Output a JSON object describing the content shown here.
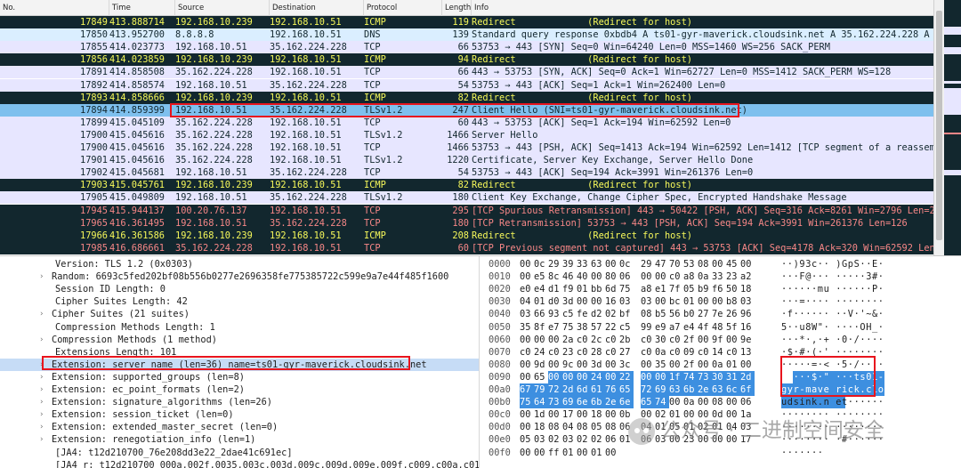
{
  "packet_list": {
    "columns": [
      "No.",
      "Time",
      "Source",
      "Destination",
      "Protocol",
      "Length",
      "Info"
    ],
    "rows": [
      {
        "no": "17849",
        "time": "413.888714",
        "src": "192.168.10.239",
        "dst": "192.168.10.51",
        "proto": "ICMP",
        "len": "119",
        "info": "Redirect             (Redirect for host)",
        "style": "icmp"
      },
      {
        "no": "17850",
        "time": "413.952700",
        "src": "8.8.8.8",
        "dst": "192.168.10.51",
        "proto": "DNS",
        "len": "139",
        "info": "Standard query response 0xbdb4 A ts01-gyr-maverick.cloudsink.net A 35.162.224.228 A 100…",
        "style": "dns"
      },
      {
        "no": "17855",
        "time": "414.023773",
        "src": "192.168.10.51",
        "dst": "35.162.224.228",
        "proto": "TCP",
        "len": "66",
        "info": "53753 → 443 [SYN] Seq=0 Win=64240 Len=0 MSS=1460 WS=256 SACK_PERM",
        "style": "tcp"
      },
      {
        "no": "17856",
        "time": "414.023859",
        "src": "192.168.10.239",
        "dst": "192.168.10.51",
        "proto": "ICMP",
        "len": "94",
        "info": "Redirect             (Redirect for host)",
        "style": "icmp"
      },
      {
        "no": "17891",
        "time": "414.858508",
        "src": "35.162.224.228",
        "dst": "192.168.10.51",
        "proto": "TCP",
        "len": "66",
        "info": "443 → 53753 [SYN, ACK] Seq=0 Ack=1 Win=62727 Len=0 MSS=1412 SACK_PERM WS=128",
        "style": "tcp"
      },
      {
        "no": "17892",
        "time": "414.858574",
        "src": "192.168.10.51",
        "dst": "35.162.224.228",
        "proto": "TCP",
        "len": "54",
        "info": "53753 → 443 [ACK] Seq=1 Ack=1 Win=262400 Len=0",
        "style": "tcp"
      },
      {
        "no": "17893",
        "time": "414.858666",
        "src": "192.168.10.239",
        "dst": "192.168.10.51",
        "proto": "ICMP",
        "len": "82",
        "info": "Redirect             (Redirect for host)",
        "style": "icmp"
      },
      {
        "no": "17894",
        "time": "414.859399",
        "src": "192.168.10.51",
        "dst": "35.162.224.228",
        "proto": "TLSv1.2",
        "len": "247",
        "info": "Client Hello (SNI=ts01-gyr-maverick.cloudsink.net)",
        "style": "selected"
      },
      {
        "no": "17899",
        "time": "415.045109",
        "src": "35.162.224.228",
        "dst": "192.168.10.51",
        "proto": "TCP",
        "len": "60",
        "info": "443 → 53753 [ACK] Seq=1 Ack=194 Win=62592 Len=0",
        "style": "tcp"
      },
      {
        "no": "17900",
        "time": "415.045616",
        "src": "35.162.224.228",
        "dst": "192.168.10.51",
        "proto": "TLSv1.2",
        "len": "1466",
        "info": "Server Hello",
        "style": "tls"
      },
      {
        "no": "17900",
        "time": "415.045616",
        "src": "35.162.224.228",
        "dst": "192.168.10.51",
        "proto": "TCP",
        "len": "1466",
        "info": "53753 → 443 [PSH, ACK] Seq=1413 Ack=194 Win=62592 Len=1412 [TCP segment of a reassemble…",
        "style": "tcp"
      },
      {
        "no": "17901",
        "time": "415.045616",
        "src": "35.162.224.228",
        "dst": "192.168.10.51",
        "proto": "TLSv1.2",
        "len": "1220",
        "info": "Certificate, Server Key Exchange, Server Hello Done",
        "style": "tls"
      },
      {
        "no": "17902",
        "time": "415.045681",
        "src": "192.168.10.51",
        "dst": "35.162.224.228",
        "proto": "TCP",
        "len": "54",
        "info": "53753 → 443 [ACK] Seq=194 Ack=3991 Win=261376 Len=0",
        "style": "tcp"
      },
      {
        "no": "17903",
        "time": "415.045761",
        "src": "192.168.10.239",
        "dst": "192.168.10.51",
        "proto": "ICMP",
        "len": "82",
        "info": "Redirect             (Redirect for host)",
        "style": "icmp"
      },
      {
        "no": "17905",
        "time": "415.049809",
        "src": "192.168.10.51",
        "dst": "35.162.224.228",
        "proto": "TLSv1.2",
        "len": "180",
        "info": "Client Key Exchange, Change Cipher Spec, Encrypted Handshake Message",
        "style": "tls"
      },
      {
        "no": "17945",
        "time": "415.944137",
        "src": "100.20.76.137",
        "dst": "192.168.10.51",
        "proto": "TCP",
        "len": "295",
        "info": "[TCP Spurious Retransmission] 443 → 50422 [PSH, ACK] Seq=316 Ack=8261 Win=2796 Len=241",
        "style": "tcpbad"
      },
      {
        "no": "17965",
        "time": "416.361495",
        "src": "192.168.10.51",
        "dst": "35.162.224.228",
        "proto": "TCP",
        "len": "180",
        "info": "[TCP Retransmission] 53753 → 443 [PSH, ACK] Seq=194 Ack=3991 Win=261376 Len=126",
        "style": "tcpbad"
      },
      {
        "no": "17966",
        "time": "416.361586",
        "src": "192.168.10.239",
        "dst": "192.168.10.51",
        "proto": "ICMP",
        "len": "208",
        "info": "Redirect             (Redirect for host)",
        "style": "icmp"
      },
      {
        "no": "17985",
        "time": "416.686661",
        "src": "35.162.224.228",
        "dst": "192.168.10.51",
        "proto": "TCP",
        "len": "60",
        "info": "[TCP Previous segment not captured] 443 → 53753 [ACK] Seq=4178 Ack=320 Win=62592 Len=0",
        "style": "tcpbad"
      }
    ]
  },
  "details": {
    "lines": [
      {
        "text": "Version: TLS 1.2 (0x0303)",
        "arrow": "",
        "selected": false
      },
      {
        "text": "Random: 6693c5fed202bf08b556b0277e2696358fe775385722c599e9a7e44f485f1600",
        "arrow": "›",
        "selected": false
      },
      {
        "text": "Session ID Length: 0",
        "arrow": "",
        "selected": false
      },
      {
        "text": "Cipher Suites Length: 42",
        "arrow": "",
        "selected": false
      },
      {
        "text": "Cipher Suites (21 suites)",
        "arrow": "›",
        "selected": false
      },
      {
        "text": "Compression Methods Length: 1",
        "arrow": "",
        "selected": false
      },
      {
        "text": "Compression Methods (1 method)",
        "arrow": "›",
        "selected": false
      },
      {
        "text": "Extensions Length: 101",
        "arrow": "",
        "selected": false
      },
      {
        "text": "Extension: server_name (len=36) name=ts01-gyr-maverick.cloudsink.net",
        "arrow": "›",
        "selected": true
      },
      {
        "text": "Extension: supported_groups (len=8)",
        "arrow": "›",
        "selected": false
      },
      {
        "text": "Extension: ec_point_formats (len=2)",
        "arrow": "›",
        "selected": false
      },
      {
        "text": "Extension: signature_algorithms (len=26)",
        "arrow": "›",
        "selected": false
      },
      {
        "text": "Extension: session_ticket (len=0)",
        "arrow": "›",
        "selected": false
      },
      {
        "text": "Extension: extended_master_secret (len=0)",
        "arrow": "›",
        "selected": false
      },
      {
        "text": "Extension: renegotiation_info (len=1)",
        "arrow": "›",
        "selected": false
      },
      {
        "text": "[JA4: t12d210700_76e208dd3e22_2dae41c691ec]",
        "arrow": "",
        "selected": false
      },
      {
        "text": "[JA4_r: t12d210700_000a,002f,0035,003c,003d,009c,009d,009e,009f,c009,c00a,c013,c0",
        "arrow": "",
        "selected": false
      }
    ]
  },
  "bytes": {
    "rows": [
      {
        "offset": "0000",
        "hex": [
          "00",
          "0c",
          "29",
          "39",
          "33",
          "63",
          "00",
          "0c",
          "29",
          "47",
          "70",
          "53",
          "08",
          "00",
          "45",
          "00"
        ],
        "ascii": "··)93c·· )GpS··E·"
      },
      {
        "offset": "0010",
        "hex": [
          "00",
          "e5",
          "8c",
          "46",
          "40",
          "00",
          "80",
          "06",
          "00",
          "00",
          "c0",
          "a8",
          "0a",
          "33",
          "23",
          "a2"
        ],
        "ascii": "···F@··· ·····3#·"
      },
      {
        "offset": "0020",
        "hex": [
          "e0",
          "e4",
          "d1",
          "f9",
          "01",
          "bb",
          "6d",
          "75",
          "a8",
          "e1",
          "7f",
          "05",
          "b9",
          "f6",
          "50",
          "18"
        ],
        "ascii": "······mu ······P·"
      },
      {
        "offset": "0030",
        "hex": [
          "04",
          "01",
          "d0",
          "3d",
          "00",
          "00",
          "16",
          "03",
          "03",
          "00",
          "bc",
          "01",
          "00",
          "00",
          "b8",
          "03"
        ],
        "ascii": "···=···· ········"
      },
      {
        "offset": "0040",
        "hex": [
          "03",
          "66",
          "93",
          "c5",
          "fe",
          "d2",
          "02",
          "bf",
          "08",
          "b5",
          "56",
          "b0",
          "27",
          "7e",
          "26",
          "96"
        ],
        "ascii": "·f······ ··V·'~&·"
      },
      {
        "offset": "0050",
        "hex": [
          "35",
          "8f",
          "e7",
          "75",
          "38",
          "57",
          "22",
          "c5",
          "99",
          "e9",
          "a7",
          "e4",
          "4f",
          "48",
          "5f",
          "16"
        ],
        "ascii": "5··u8W\"· ····OH_·"
      },
      {
        "offset": "0060",
        "hex": [
          "00",
          "00",
          "00",
          "2a",
          "c0",
          "2c",
          "c0",
          "2b",
          "c0",
          "30",
          "c0",
          "2f",
          "00",
          "9f",
          "00",
          "9e"
        ],
        "ascii": "···*·,·+ ·0·/····"
      },
      {
        "offset": "0070",
        "hex": [
          "c0",
          "24",
          "c0",
          "23",
          "c0",
          "28",
          "c0",
          "27",
          "c0",
          "0a",
          "c0",
          "09",
          "c0",
          "14",
          "c0",
          "13"
        ],
        "ascii": "·$·#·(·' ········"
      },
      {
        "offset": "0080",
        "hex": [
          "00",
          "9d",
          "00",
          "9c",
          "00",
          "3d",
          "00",
          "3c",
          "00",
          "35",
          "00",
          "2f",
          "00",
          "0a",
          "01",
          "00"
        ],
        "ascii": "·····=·< ·5·/····"
      },
      {
        "offset": "0090",
        "hex": [
          "00",
          "65",
          "00",
          "00",
          "00",
          "24",
          "00",
          "22",
          "00",
          "00",
          "1f",
          "74",
          "73",
          "30",
          "31",
          "2d"
        ],
        "ascii": "·e···$·\" ···ts01-"
      },
      {
        "offset": "00a0",
        "hex": [
          "67",
          "79",
          "72",
          "2d",
          "6d",
          "61",
          "76",
          "65",
          "72",
          "69",
          "63",
          "6b",
          "2e",
          "63",
          "6c",
          "6f"
        ],
        "ascii": "gyr-mave rick.clo"
      },
      {
        "offset": "00b0",
        "hex": [
          "75",
          "64",
          "73",
          "69",
          "6e",
          "6b",
          "2e",
          "6e",
          "65",
          "74",
          "00",
          "0a",
          "00",
          "08",
          "00",
          "06"
        ],
        "ascii": "udsink.n et······"
      },
      {
        "offset": "00c0",
        "hex": [
          "00",
          "1d",
          "00",
          "17",
          "00",
          "18",
          "00",
          "0b",
          "00",
          "02",
          "01",
          "00",
          "00",
          "0d",
          "00",
          "1a"
        ],
        "ascii": "········ ········"
      },
      {
        "offset": "00d0",
        "hex": [
          "00",
          "18",
          "08",
          "04",
          "08",
          "05",
          "08",
          "06",
          "04",
          "01",
          "05",
          "01",
          "02",
          "01",
          "04",
          "03"
        ],
        "ascii": "········ ········"
      },
      {
        "offset": "00e0",
        "hex": [
          "05",
          "03",
          "02",
          "03",
          "02",
          "02",
          "06",
          "01",
          "06",
          "03",
          "00",
          "23",
          "00",
          "00",
          "00",
          "17"
        ],
        "ascii": "········ ·#······"
      },
      {
        "offset": "00f0",
        "hex": [
          "00",
          "00",
          "ff",
          "01",
          "00",
          "01",
          "00",
          "",
          "",
          "",
          "",
          "",
          "",
          "",
          "",
          ""
        ],
        "ascii": "·······"
      }
    ]
  },
  "watermark": {
    "text": "公众号 · 二进制空间安全",
    "icon": "wechat-icon"
  },
  "colors": {
    "icmp_bg": "#12272e",
    "icmp_fg": "#f7f95a",
    "tcp_bg": "#e7e6ff",
    "dns_bg": "#daeeff",
    "selected_bg": "#7ec0ee",
    "bad_fg": "#f78787",
    "highlight_box": "#e8141d",
    "byte_highlight": "#3d8fe0"
  }
}
